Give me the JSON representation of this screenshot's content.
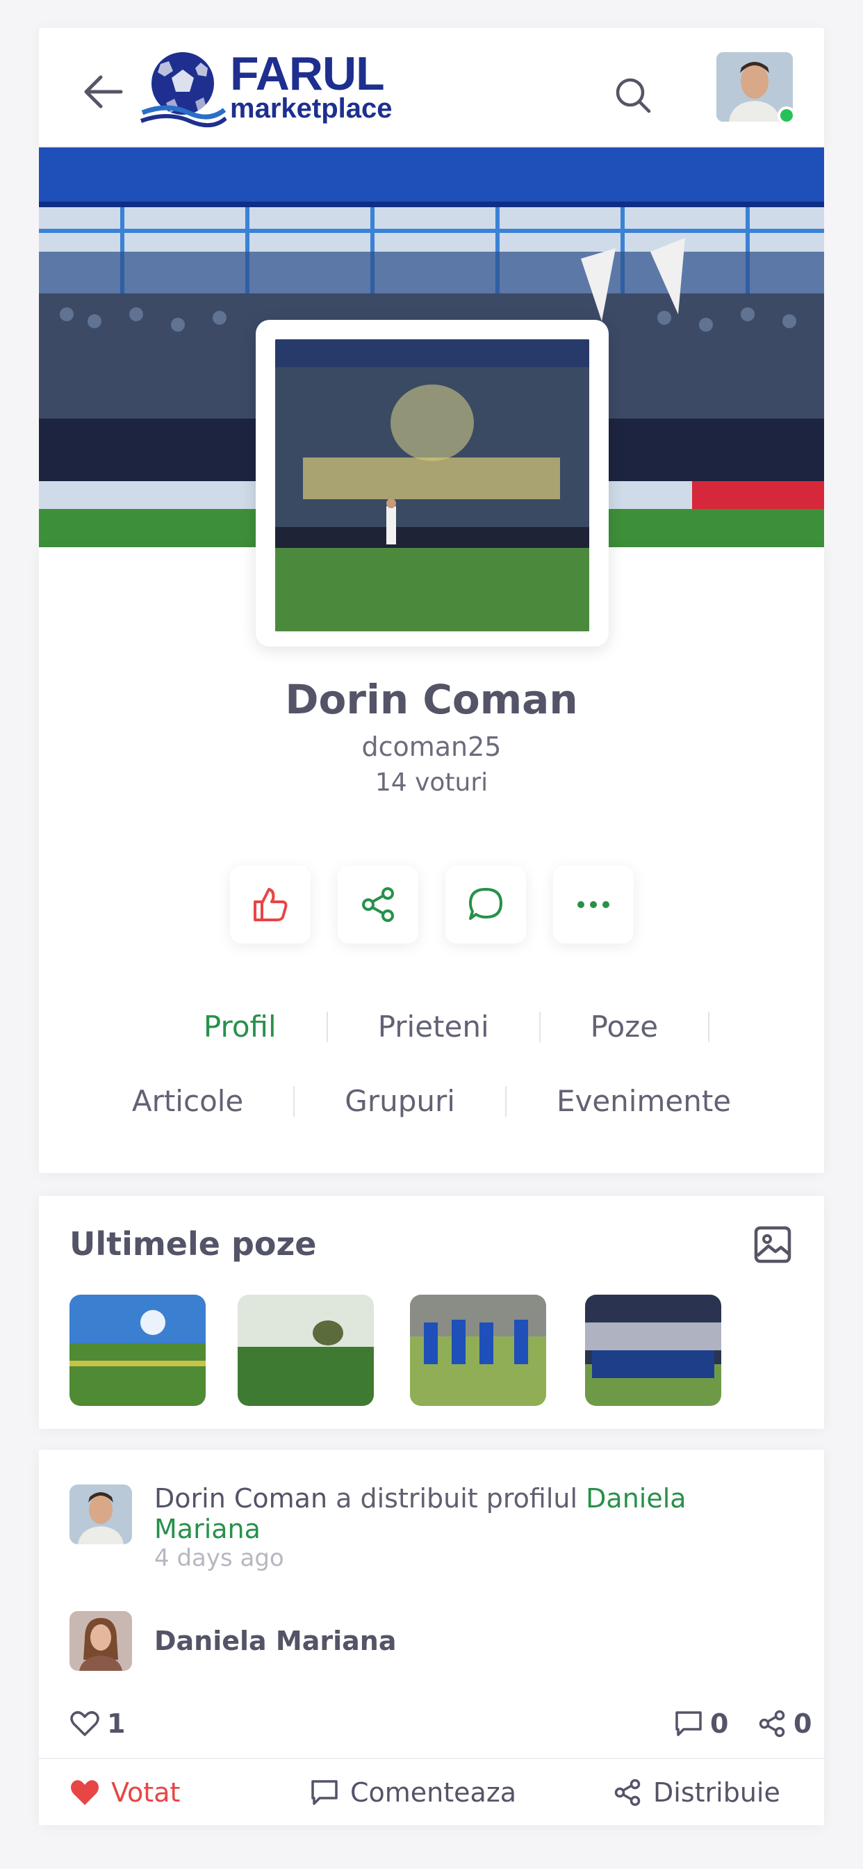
{
  "header": {
    "logo_line1": "FARUL",
    "logo_line2": "marketplace",
    "icons": [
      "back-arrow-icon",
      "search-icon",
      "user-avatar"
    ]
  },
  "profile": {
    "name": "Dorin Coman",
    "username": "dcoman25",
    "votes": "14 voturi"
  },
  "actions": [
    {
      "name": "like",
      "icon": "thumbs-up-icon",
      "color": "#e84545"
    },
    {
      "name": "share",
      "icon": "share-icon",
      "color": "#27914a"
    },
    {
      "name": "message",
      "icon": "chat-bubble-icon",
      "color": "#27914a"
    },
    {
      "name": "more",
      "icon": "more-dots-icon",
      "color": "#27914a"
    }
  ],
  "tabs": {
    "row1": [
      "Profil",
      "Prieteni",
      "Poze"
    ],
    "row2": [
      "Articole",
      "Grupuri",
      "Evenimente"
    ],
    "active": "Profil"
  },
  "photos": {
    "title": "Ultimele poze",
    "icon": "image-icon"
  },
  "feed": {
    "actor": "Dorin Coman",
    "action_text": " a distribuit profilul ",
    "target": "Daniela Mariana",
    "time": "4 days ago",
    "shared_user": "Daniela Mariana",
    "likes": "1",
    "comments": "0",
    "shares": "0",
    "buttons": {
      "vote": "Votat",
      "comment": "Comenteaza",
      "share": "Distribuie"
    }
  },
  "colors": {
    "accent_green": "#27914a",
    "vote_red": "#e84545",
    "brand_blue": "#1e2f8f",
    "online": "#27c15a"
  }
}
